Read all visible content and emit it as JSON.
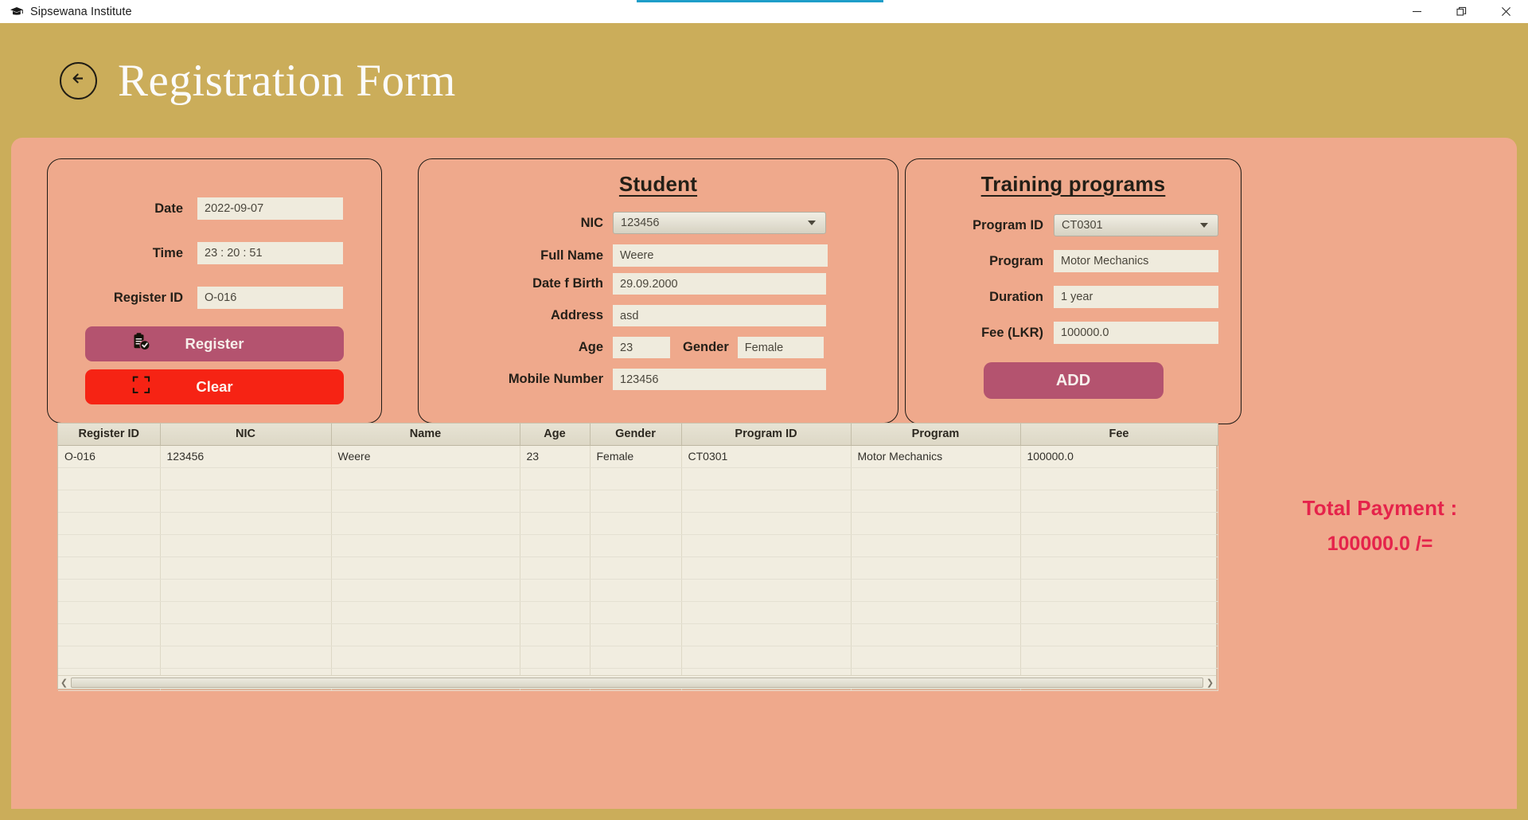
{
  "window": {
    "app_title": "Sipsewana Institute",
    "app_icon": "graduation-cap-icon",
    "controls": {
      "minimize": "minimize-icon",
      "restore": "restore-icon",
      "close": "close-icon"
    }
  },
  "header": {
    "back_icon": "arrow-left-icon",
    "title": "Registration Form"
  },
  "left_panel": {
    "fields": [
      {
        "label": "Date",
        "value": "2022-09-07"
      },
      {
        "label": "Time",
        "value": "23 : 20 : 51"
      },
      {
        "label": "Register ID",
        "value": "O-016"
      }
    ],
    "register_button": {
      "label": "Register",
      "icon": "clipboard-check-icon"
    },
    "clear_button": {
      "label": "Clear",
      "icon": "document-x-icon"
    }
  },
  "student_panel": {
    "title": "Student",
    "nic": {
      "label": "NIC",
      "value": "123456"
    },
    "full_name": {
      "label": "Full Name",
      "value": "Weere"
    },
    "dob": {
      "label": "Date f Birth",
      "value": "29.09.2000"
    },
    "address": {
      "label": "Address",
      "value": "asd"
    },
    "age": {
      "label": "Age",
      "value": "23"
    },
    "gender": {
      "label": "Gender",
      "value": "Female"
    },
    "mobile": {
      "label": "Mobile Number",
      "value": "123456"
    }
  },
  "training_panel": {
    "title": "Training programs",
    "program_id": {
      "label": "Program ID",
      "value": "CT0301"
    },
    "program": {
      "label": "Program",
      "value": "Motor Mechanics"
    },
    "duration": {
      "label": "Duration",
      "value": "1 year"
    },
    "fee": {
      "label": "Fee (LKR)",
      "value": "100000.0"
    },
    "add_button": {
      "label": "ADD"
    }
  },
  "table": {
    "headers": [
      "Register ID",
      "NIC",
      "Name",
      "Age",
      "Gender",
      "Program ID",
      "Program",
      "Fee"
    ],
    "rows": [
      {
        "register_id": "O-016",
        "nic": "123456",
        "name": "Weere",
        "age": "23",
        "gender": "Female",
        "program_id": "CT0301",
        "program": "Motor Mechanics",
        "fee": "100000.0"
      }
    ],
    "empty_row_count": 10,
    "scroll_left_icon": "chevron-left-icon",
    "scroll_right_icon": "chevron-right-icon"
  },
  "total": {
    "label": "Total Payment :",
    "value": "100000.0 /="
  },
  "colors": {
    "header_bar": "#cbad5a",
    "body": "#efa98c",
    "primary_button": "#b4536f",
    "danger_button": "#f62314",
    "total_text": "#e5234b",
    "field_bg": "#efebdd"
  }
}
